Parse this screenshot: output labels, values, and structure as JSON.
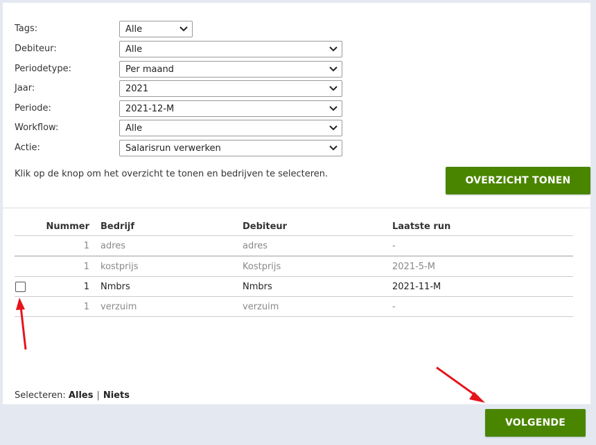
{
  "filters": {
    "tags": {
      "label": "Tags:",
      "value": "Alle"
    },
    "debiteur": {
      "label": "Debiteur:",
      "value": "Alle"
    },
    "periodetype": {
      "label": "Periodetype:",
      "value": "Per maand"
    },
    "jaar": {
      "label": "Jaar:",
      "value": "2021"
    },
    "periode": {
      "label": "Periode:",
      "value": "2021-12-M"
    },
    "workflow": {
      "label": "Workflow:",
      "value": "Alle"
    },
    "actie": {
      "label": "Actie:",
      "value": "Salarisrun verwerken"
    }
  },
  "help_text": "Klik op de knop om het overzicht te tonen en bedrijven te selecteren.",
  "overzicht_button": "OVERZICHT TONEN",
  "table": {
    "headers": {
      "nummer": "Nummer",
      "bedrijf": "Bedrijf",
      "debiteur": "Debiteur",
      "laatste_run": "Laatste run"
    },
    "rows": [
      {
        "nummer": "1",
        "bedrijf": "adres",
        "debiteur": "adres",
        "laatste_run": "-"
      },
      {
        "nummer": "1",
        "bedrijf": "kostprijs",
        "debiteur": "Kostprijs",
        "laatste_run": "2021-5-M"
      },
      {
        "nummer": "1",
        "bedrijf": "Nmbrs",
        "debiteur": "Nmbrs",
        "laatste_run": "2021-11-M"
      },
      {
        "nummer": "1",
        "bedrijf": "verzuim",
        "debiteur": "verzuim",
        "laatste_run": "-"
      }
    ]
  },
  "selecteren": {
    "label": "Selecteren:",
    "alles": "Alles",
    "separator": "|",
    "niets": "Niets"
  },
  "volgende_button": "VOLGENDE",
  "colors": {
    "accent_green": "#4a8500",
    "annotation_red": "#e5141b",
    "background": "#e4e9f1"
  }
}
